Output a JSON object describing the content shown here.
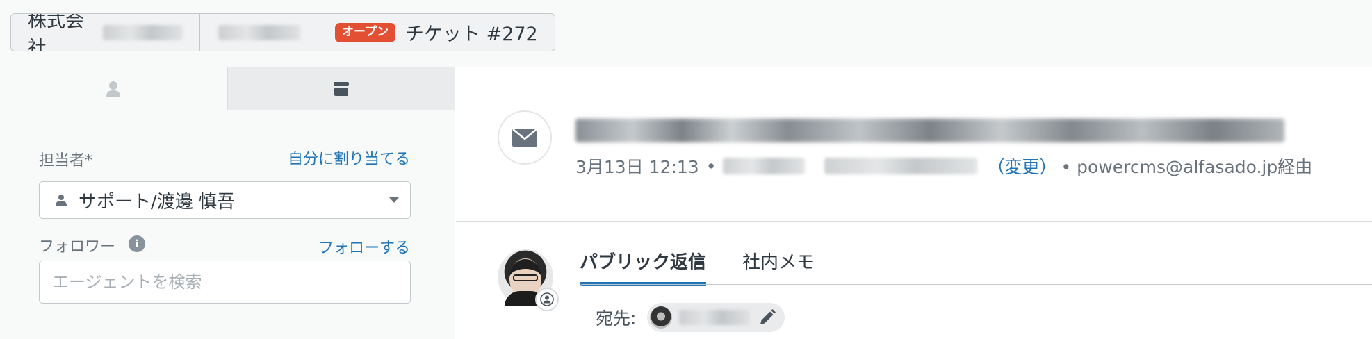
{
  "breadcrumbs": {
    "org_prefix": "株式会社",
    "ticket_status_badge": "オープン",
    "ticket_label": "チケット #272"
  },
  "sidebar": {
    "tabs": [
      {
        "icon": "user-icon"
      },
      {
        "icon": "archive-icon"
      }
    ],
    "assignee": {
      "label": "担当者*",
      "assign_self_link": "自分に割り当てる",
      "value": "サポート/渡邊 慎吾"
    },
    "followers": {
      "label": "フォロワー",
      "follow_link": "フォローする",
      "search_placeholder": "エージェントを検索"
    }
  },
  "ticket": {
    "meta": {
      "datetime": "3月13日 12:13",
      "bullet": "•",
      "change_link": "（変更）",
      "via": "• powercms@alfasado.jp経由"
    }
  },
  "composer": {
    "tabs": [
      {
        "label": "パブリック返信",
        "active": true
      },
      {
        "label": "社内メモ",
        "active": false
      }
    ],
    "to_label": "宛先:"
  },
  "colors": {
    "accent": "#1f73b7",
    "open_badge": "#e34f32"
  }
}
